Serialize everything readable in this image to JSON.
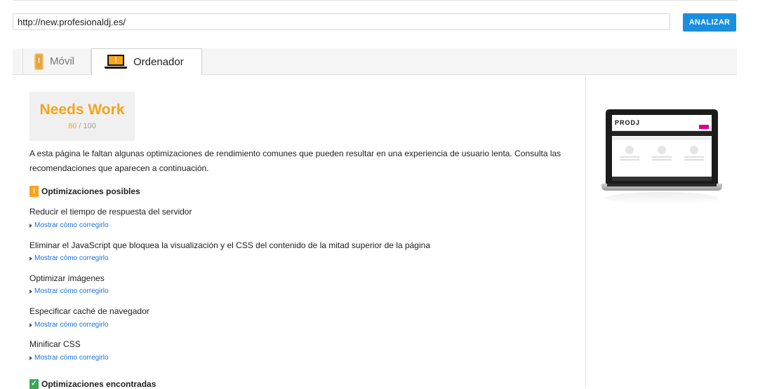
{
  "url_bar": {
    "value": "http://new.profesionaldj.es/",
    "button_label": "ANALIZAR"
  },
  "tabs": [
    {
      "label": "Móvil",
      "icon": "mobile-warning-icon",
      "active": false
    },
    {
      "label": "Ordenador",
      "icon": "desktop-warning-icon",
      "active": true
    }
  ],
  "score": {
    "status": "Needs Work",
    "value": "80",
    "max": "/ 100",
    "status_color": "#f7a41d"
  },
  "summary": "A esta página le faltan algunas optimizaciones de rendimiento comunes que pueden resultar en una experiencia de usuario lenta. Consulta las recomendaciones que aparecen a continuación.",
  "possible_section": {
    "badge": "!",
    "title": "Optimizaciones posibles"
  },
  "rules": [
    {
      "title": "Reducir el tiempo de respuesta del servidor",
      "link": "Mostrar cómo corregirlo"
    },
    {
      "title": "Eliminar el JavaScript que bloquea la visualización y el CSS del contenido de la mitad superior de la página",
      "link": "Mostrar cómo corregirlo"
    },
    {
      "title": "Optimizar imágenes",
      "link": "Mostrar cómo corregirlo"
    },
    {
      "title": "Especificar caché de navegador",
      "link": "Mostrar cómo corregirlo"
    },
    {
      "title": "Minificar CSS",
      "link": "Mostrar cómo corregirlo"
    }
  ],
  "found_section": {
    "badge": "✓",
    "title": "Optimizaciones encontradas"
  },
  "preview": {
    "logo_text": "PRODJ"
  },
  "colors": {
    "accent": "#1a8fe0",
    "warning": "#f7a41d",
    "success": "#3aa757",
    "link": "#1a73d9"
  }
}
